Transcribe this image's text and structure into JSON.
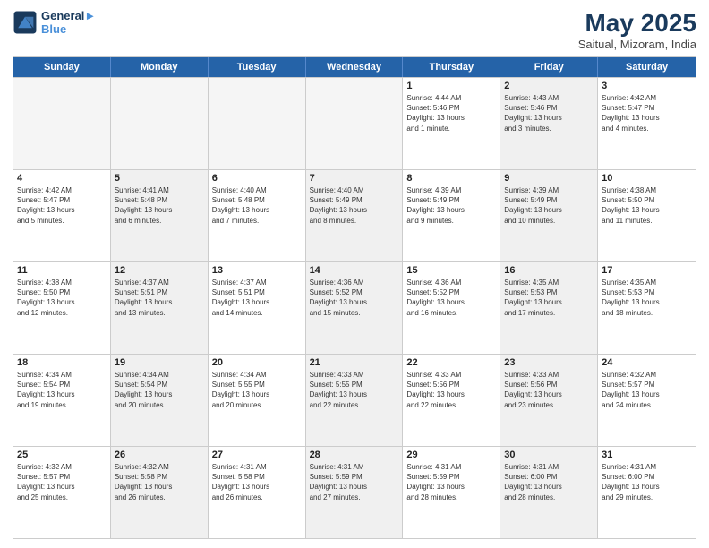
{
  "header": {
    "logo_line1": "General",
    "logo_line2": "Blue",
    "month": "May 2025",
    "location": "Saitual, Mizoram, India"
  },
  "weekdays": [
    "Sunday",
    "Monday",
    "Tuesday",
    "Wednesday",
    "Thursday",
    "Friday",
    "Saturday"
  ],
  "rows": [
    [
      {
        "day": "",
        "info": "",
        "empty": true
      },
      {
        "day": "",
        "info": "",
        "empty": true
      },
      {
        "day": "",
        "info": "",
        "empty": true
      },
      {
        "day": "",
        "info": "",
        "empty": true
      },
      {
        "day": "1",
        "info": "Sunrise: 4:44 AM\nSunset: 5:46 PM\nDaylight: 13 hours\nand 1 minute."
      },
      {
        "day": "2",
        "info": "Sunrise: 4:43 AM\nSunset: 5:46 PM\nDaylight: 13 hours\nand 3 minutes.",
        "shaded": true
      },
      {
        "day": "3",
        "info": "Sunrise: 4:42 AM\nSunset: 5:47 PM\nDaylight: 13 hours\nand 4 minutes."
      }
    ],
    [
      {
        "day": "4",
        "info": "Sunrise: 4:42 AM\nSunset: 5:47 PM\nDaylight: 13 hours\nand 5 minutes."
      },
      {
        "day": "5",
        "info": "Sunrise: 4:41 AM\nSunset: 5:48 PM\nDaylight: 13 hours\nand 6 minutes.",
        "shaded": true
      },
      {
        "day": "6",
        "info": "Sunrise: 4:40 AM\nSunset: 5:48 PM\nDaylight: 13 hours\nand 7 minutes."
      },
      {
        "day": "7",
        "info": "Sunrise: 4:40 AM\nSunset: 5:49 PM\nDaylight: 13 hours\nand 8 minutes.",
        "shaded": true
      },
      {
        "day": "8",
        "info": "Sunrise: 4:39 AM\nSunset: 5:49 PM\nDaylight: 13 hours\nand 9 minutes."
      },
      {
        "day": "9",
        "info": "Sunrise: 4:39 AM\nSunset: 5:49 PM\nDaylight: 13 hours\nand 10 minutes.",
        "shaded": true
      },
      {
        "day": "10",
        "info": "Sunrise: 4:38 AM\nSunset: 5:50 PM\nDaylight: 13 hours\nand 11 minutes."
      }
    ],
    [
      {
        "day": "11",
        "info": "Sunrise: 4:38 AM\nSunset: 5:50 PM\nDaylight: 13 hours\nand 12 minutes."
      },
      {
        "day": "12",
        "info": "Sunrise: 4:37 AM\nSunset: 5:51 PM\nDaylight: 13 hours\nand 13 minutes.",
        "shaded": true
      },
      {
        "day": "13",
        "info": "Sunrise: 4:37 AM\nSunset: 5:51 PM\nDaylight: 13 hours\nand 14 minutes."
      },
      {
        "day": "14",
        "info": "Sunrise: 4:36 AM\nSunset: 5:52 PM\nDaylight: 13 hours\nand 15 minutes.",
        "shaded": true
      },
      {
        "day": "15",
        "info": "Sunrise: 4:36 AM\nSunset: 5:52 PM\nDaylight: 13 hours\nand 16 minutes."
      },
      {
        "day": "16",
        "info": "Sunrise: 4:35 AM\nSunset: 5:53 PM\nDaylight: 13 hours\nand 17 minutes.",
        "shaded": true
      },
      {
        "day": "17",
        "info": "Sunrise: 4:35 AM\nSunset: 5:53 PM\nDaylight: 13 hours\nand 18 minutes."
      }
    ],
    [
      {
        "day": "18",
        "info": "Sunrise: 4:34 AM\nSunset: 5:54 PM\nDaylight: 13 hours\nand 19 minutes."
      },
      {
        "day": "19",
        "info": "Sunrise: 4:34 AM\nSunset: 5:54 PM\nDaylight: 13 hours\nand 20 minutes.",
        "shaded": true
      },
      {
        "day": "20",
        "info": "Sunrise: 4:34 AM\nSunset: 5:55 PM\nDaylight: 13 hours\nand 20 minutes."
      },
      {
        "day": "21",
        "info": "Sunrise: 4:33 AM\nSunset: 5:55 PM\nDaylight: 13 hours\nand 22 minutes.",
        "shaded": true
      },
      {
        "day": "22",
        "info": "Sunrise: 4:33 AM\nSunset: 5:56 PM\nDaylight: 13 hours\nand 22 minutes."
      },
      {
        "day": "23",
        "info": "Sunrise: 4:33 AM\nSunset: 5:56 PM\nDaylight: 13 hours\nand 23 minutes.",
        "shaded": true
      },
      {
        "day": "24",
        "info": "Sunrise: 4:32 AM\nSunset: 5:57 PM\nDaylight: 13 hours\nand 24 minutes."
      }
    ],
    [
      {
        "day": "25",
        "info": "Sunrise: 4:32 AM\nSunset: 5:57 PM\nDaylight: 13 hours\nand 25 minutes."
      },
      {
        "day": "26",
        "info": "Sunrise: 4:32 AM\nSunset: 5:58 PM\nDaylight: 13 hours\nand 26 minutes.",
        "shaded": true
      },
      {
        "day": "27",
        "info": "Sunrise: 4:31 AM\nSunset: 5:58 PM\nDaylight: 13 hours\nand 26 minutes."
      },
      {
        "day": "28",
        "info": "Sunrise: 4:31 AM\nSunset: 5:59 PM\nDaylight: 13 hours\nand 27 minutes.",
        "shaded": true
      },
      {
        "day": "29",
        "info": "Sunrise: 4:31 AM\nSunset: 5:59 PM\nDaylight: 13 hours\nand 28 minutes."
      },
      {
        "day": "30",
        "info": "Sunrise: 4:31 AM\nSunset: 6:00 PM\nDaylight: 13 hours\nand 28 minutes.",
        "shaded": true
      },
      {
        "day": "31",
        "info": "Sunrise: 4:31 AM\nSunset: 6:00 PM\nDaylight: 13 hours\nand 29 minutes."
      }
    ]
  ]
}
